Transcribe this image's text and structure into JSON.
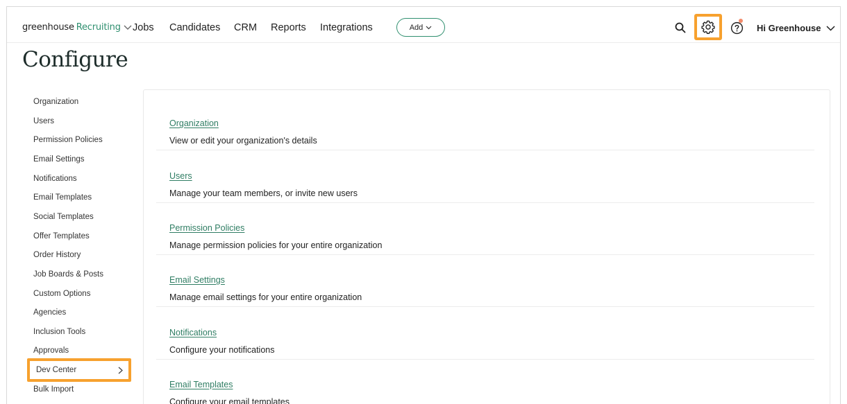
{
  "nav": {
    "logo_main": "greenhouse",
    "logo_sub": "Recruiting",
    "links": [
      "Jobs",
      "Candidates",
      "CRM",
      "Reports",
      "Integrations"
    ],
    "add_label": "Add",
    "user_label": "Hi Greenhouse"
  },
  "page": {
    "title": "Configure"
  },
  "sidebar": {
    "items": [
      "Organization",
      "Users",
      "Permission Policies",
      "Email Settings",
      "Notifications",
      "Email Templates",
      "Social Templates",
      "Offer Templates",
      "Order History",
      "Job Boards & Posts",
      "Custom Options",
      "Agencies",
      "Inclusion Tools",
      "Approvals",
      "Dev Center",
      "Bulk Import"
    ],
    "active_index": 14
  },
  "sections": [
    {
      "title": "Organization",
      "desc": "View or edit your organization's details"
    },
    {
      "title": "Users",
      "desc": "Manage your team members, or invite new users"
    },
    {
      "title": "Permission Policies",
      "desc": "Manage permission policies for your entire organization"
    },
    {
      "title": "Email Settings",
      "desc": "Manage email settings for your entire organization"
    },
    {
      "title": "Notifications",
      "desc": "Configure your notifications"
    },
    {
      "title": "Email Templates",
      "desc": "Configure your email templates"
    }
  ],
  "colors": {
    "accent_green": "#2f8f6f",
    "link_green": "#2f7d63",
    "highlight_orange": "#f7a12e",
    "notification_dot": "#f28b6b"
  },
  "icons": {
    "search": "search-icon",
    "settings": "gear-icon",
    "help": "help-icon"
  }
}
